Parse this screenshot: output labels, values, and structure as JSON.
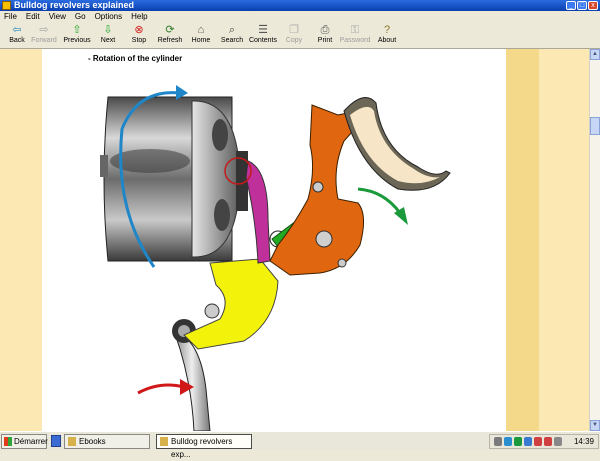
{
  "window": {
    "title": "Bulldog revolvers explained"
  },
  "menu": [
    "File",
    "Edit",
    "View",
    "Go",
    "Options",
    "Help"
  ],
  "toolbar": [
    {
      "label": "Back",
      "icon": "back-arrow-icon",
      "enabled": true
    },
    {
      "label": "Forward",
      "icon": "forward-arrow-icon",
      "enabled": false
    },
    {
      "label": "Previous",
      "icon": "previous-arrow-icon",
      "enabled": true
    },
    {
      "label": "Next",
      "icon": "next-arrow-icon",
      "enabled": true
    },
    {
      "label": "Stop",
      "icon": "stop-icon",
      "enabled": true
    },
    {
      "label": "Refresh",
      "icon": "refresh-icon",
      "enabled": true
    },
    {
      "label": "Home",
      "icon": "home-icon",
      "enabled": true
    },
    {
      "label": "Search",
      "icon": "search-icon",
      "enabled": true
    },
    {
      "label": "Contents",
      "icon": "contents-icon",
      "enabled": true
    },
    {
      "label": "Copy",
      "icon": "copy-icon",
      "enabled": false
    },
    {
      "label": "Print",
      "icon": "print-icon",
      "enabled": true
    },
    {
      "label": "Password",
      "icon": "key-icon",
      "enabled": false
    },
    {
      "label": "About",
      "icon": "about-icon",
      "enabled": true
    }
  ],
  "page": {
    "heading": "Rotation of the cylinder"
  },
  "taskbar": {
    "start_label": "Démarrer",
    "tasks": [
      {
        "label": "Ebooks",
        "active": false
      },
      {
        "label": "Bulldog revolvers exp...",
        "active": true
      }
    ],
    "clock": "14:39"
  },
  "colors": {
    "pawl": "#c0309a",
    "hammer": "#e0660f",
    "trigger": "#f2f20a",
    "link": "#22aa22",
    "arrow_blue": "#1f86c8",
    "arrow_red": "#d01818",
    "arrow_green": "#1a9a3a"
  }
}
